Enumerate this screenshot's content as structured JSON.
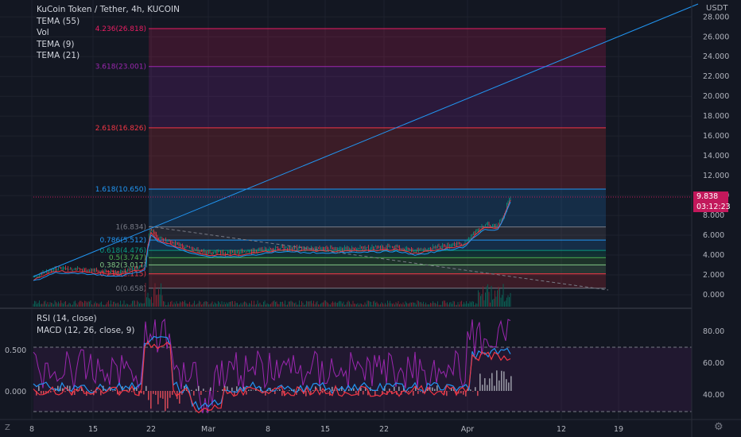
{
  "header": {
    "symbol_title": "KuCoin Token / Tether, 4h, KUCOIN",
    "indicators": [
      "TEMA (55)",
      "Vol",
      "TEMA (9)",
      "TEMA (21)"
    ],
    "currency": "USDT"
  },
  "price_tag": {
    "price": "9.838",
    "countdown": "03:12:23"
  },
  "sub_indicators": [
    "RSI (14, close)",
    "MACD (12, 26, close, 9)"
  ],
  "fib_levels": [
    {
      "label": "4.236(26.818)",
      "value": 26.818,
      "color": "#e91e63"
    },
    {
      "label": "3.618(23.001)",
      "value": 23.001,
      "color": "#9c27b0"
    },
    {
      "label": "2.618(16.826)",
      "value": 16.826,
      "color": "#f23645"
    },
    {
      "label": "1.618(10.650)",
      "value": 10.65,
      "color": "#2196f3"
    },
    {
      "label": "1(6.834)",
      "value": 6.834,
      "color": "#787b86"
    },
    {
      "label": "0.786(5.512)",
      "value": 5.512,
      "color": "#2196f3"
    },
    {
      "label": "0.618(4.476)",
      "value": 4.476,
      "color": "#089981"
    },
    {
      "label": "0.5(3.747)",
      "value": 3.747,
      "color": "#4caf50"
    },
    {
      "label": "0.382(3.017)",
      "value": 3.017,
      "color": "#81c784"
    },
    {
      "label": "0.236(2.115)",
      "value": 2.115,
      "color": "#f23645"
    },
    {
      "label": "0(0.658)",
      "value": 0.658,
      "color": "#787b86"
    }
  ],
  "price_axis": [
    "28.000",
    "26.000",
    "24.000",
    "22.000",
    "20.000",
    "18.000",
    "16.000",
    "14.000",
    "12.000",
    "10.000",
    "8.000",
    "6.000",
    "4.000",
    "2.000",
    "0.000"
  ],
  "oscillator_axis": [
    "80.00",
    "60.00",
    "40.00"
  ],
  "macd_axis": [
    "0.500",
    "0.000"
  ],
  "time_axis": [
    "8",
    "15",
    "22",
    "Mar",
    "8",
    "15",
    "22",
    "Apr",
    "12",
    "19"
  ],
  "corner_icons": {
    "left": "Z",
    "right": "gear-icon"
  },
  "colors": {
    "background": "#131722",
    "price_tag": "#c2185b",
    "trendline": "#2196f3",
    "rsi": "#9c27b0"
  }
}
